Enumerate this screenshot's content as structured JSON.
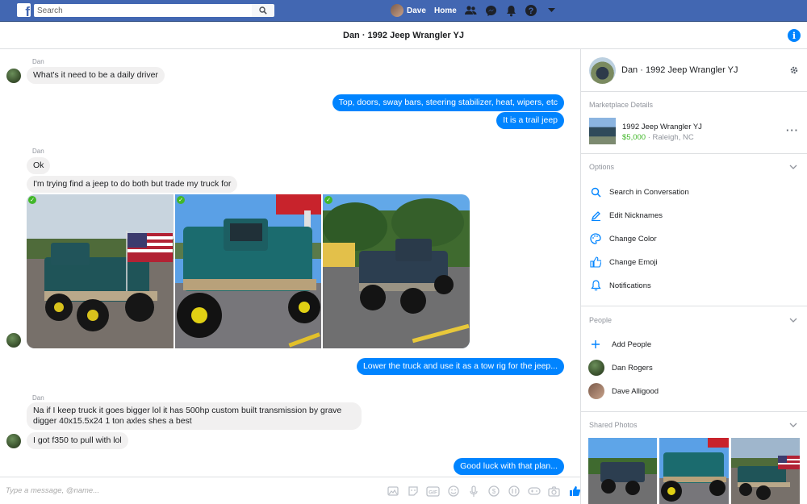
{
  "topbar": {
    "search_placeholder": "Search",
    "user_name": "Dave",
    "home_label": "Home"
  },
  "conversation": {
    "title": "Dan · 1992 Jeep Wrangler YJ"
  },
  "messages": [
    {
      "type": "sender",
      "text": "Dan"
    },
    {
      "type": "in",
      "text": "What's it need to be a daily driver"
    },
    {
      "type": "out",
      "text": "Top, doors, sway bars, steering stabilizer, heat, wipers, etc"
    },
    {
      "type": "out",
      "text": "It is a trail jeep"
    },
    {
      "type": "sender",
      "text": "Dan"
    },
    {
      "type": "in",
      "text": "Ok"
    },
    {
      "type": "in",
      "text": "I'm trying find a jeep to do both but trade my truck for"
    },
    {
      "type": "out",
      "text": "Lower the truck and use it as a tow rig for the jeep..."
    },
    {
      "type": "sender",
      "text": "Dan"
    },
    {
      "type": "in",
      "text": "Na if I keep truck it goes bigger lol it has 500hp custom built transmission by grave digger 40x15.5x24 1 ton axles  shes a best"
    },
    {
      "type": "in",
      "text": "I got f350 to pull with lol"
    },
    {
      "type": "out",
      "text": "Good luck with that plan..."
    }
  ],
  "composer": {
    "placeholder": "Type a message, @name..."
  },
  "side": {
    "title": "Dan · 1992 Jeep Wrangler YJ",
    "marketplace_label": "Marketplace Details",
    "listing_title": "1992 Jeep Wrangler YJ",
    "listing_price": "$5,000",
    "listing_location": " · Raleigh, NC",
    "options_label": "Options",
    "options": [
      {
        "icon": "search-icon",
        "label": "Search in Conversation"
      },
      {
        "icon": "pencil-icon",
        "label": "Edit Nicknames"
      },
      {
        "icon": "palette-icon",
        "label": "Change Color"
      },
      {
        "icon": "thumbs-up-icon",
        "label": "Change Emoji"
      },
      {
        "icon": "bell-icon",
        "label": "Notifications"
      }
    ],
    "people_label": "People",
    "add_people_label": "Add People",
    "people": [
      "Dan Rogers",
      "Dave Alligood"
    ],
    "shared_photos_label": "Shared Photos"
  },
  "colors": {
    "brand": "#4267b2",
    "outgoing_bubble": "#0084ff",
    "incoming_bubble": "#f1f0f0",
    "price": "#42b72a"
  }
}
